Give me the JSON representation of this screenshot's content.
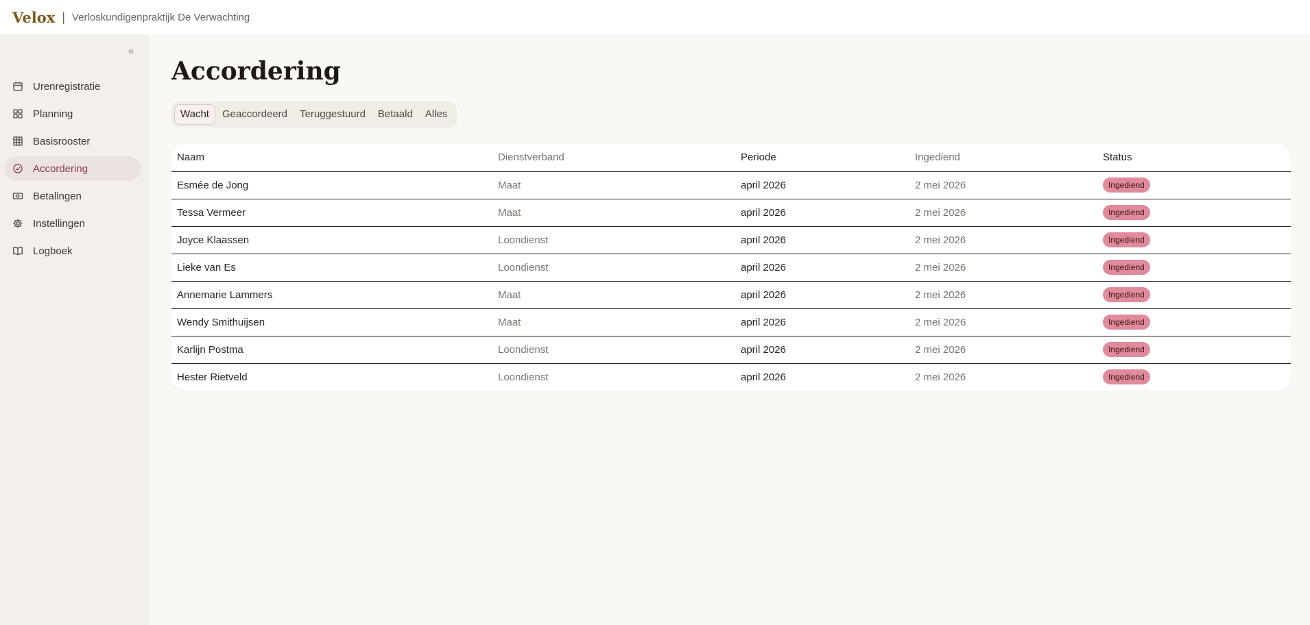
{
  "header": {
    "brand": "Velox",
    "separator": "|",
    "organization": "Verloskundigenpraktijk De Verwachting"
  },
  "sidebar": {
    "collapse_glyph": "«",
    "items": [
      {
        "label": "Urenregistratie",
        "icon": "calendar-icon"
      },
      {
        "label": "Planning",
        "icon": "grid-icon"
      },
      {
        "label": "Basisrooster",
        "icon": "table-icon"
      },
      {
        "label": "Accordering",
        "icon": "check-circle-icon",
        "active": true
      },
      {
        "label": "Betalingen",
        "icon": "banknote-icon"
      },
      {
        "label": "Instellingen",
        "icon": "gear-icon"
      },
      {
        "label": "Logboek",
        "icon": "book-icon"
      }
    ]
  },
  "main": {
    "title": "Accordering",
    "tabs": [
      {
        "label": "Wacht",
        "active": true
      },
      {
        "label": "Geaccordeerd"
      },
      {
        "label": "Teruggestuurd"
      },
      {
        "label": "Betaald"
      },
      {
        "label": "Alles"
      }
    ],
    "table": {
      "headers": {
        "naam": "Naam",
        "dienstverband": "Dienstverband",
        "periode": "Periode",
        "ingediend": "Ingediend",
        "status": "Status"
      },
      "rows": [
        {
          "naam": "Esmée de Jong",
          "dienstverband": "Maat",
          "periode": "april 2026",
          "ingediend": "2 mei 2026",
          "status": "Ingediend"
        },
        {
          "naam": "Tessa Vermeer",
          "dienstverband": "Maat",
          "periode": "april 2026",
          "ingediend": "2 mei 2026",
          "status": "Ingediend"
        },
        {
          "naam": "Joyce Klaassen",
          "dienstverband": "Loondienst",
          "periode": "april 2026",
          "ingediend": "2 mei 2026",
          "status": "Ingediend"
        },
        {
          "naam": "Lieke van Es",
          "dienstverband": "Loondienst",
          "periode": "april 2026",
          "ingediend": "2 mei 2026",
          "status": "Ingediend"
        },
        {
          "naam": "Annemarie Lammers",
          "dienstverband": "Maat",
          "periode": "april 2026",
          "ingediend": "2 mei 2026",
          "status": "Ingediend"
        },
        {
          "naam": "Wendy Smithuijsen",
          "dienstverband": "Maat",
          "periode": "april 2026",
          "ingediend": "2 mei 2026",
          "status": "Ingediend"
        },
        {
          "naam": "Karlijn Postma",
          "dienstverband": "Loondienst",
          "periode": "april 2026",
          "ingediend": "2 mei 2026",
          "status": "Ingediend"
        },
        {
          "naam": "Hester Rietveld",
          "dienstverband": "Loondienst",
          "periode": "april 2026",
          "ingediend": "2 mei 2026",
          "status": "Ingediend"
        }
      ]
    }
  },
  "colors": {
    "brand": "#7a5a1e",
    "accent": "#8a3a4a",
    "active_nav_bg": "#ece2df",
    "badge_bg": "#e08a9b",
    "page_bg": "#faf8f4",
    "sidebar_bg": "#f3f0eb"
  }
}
